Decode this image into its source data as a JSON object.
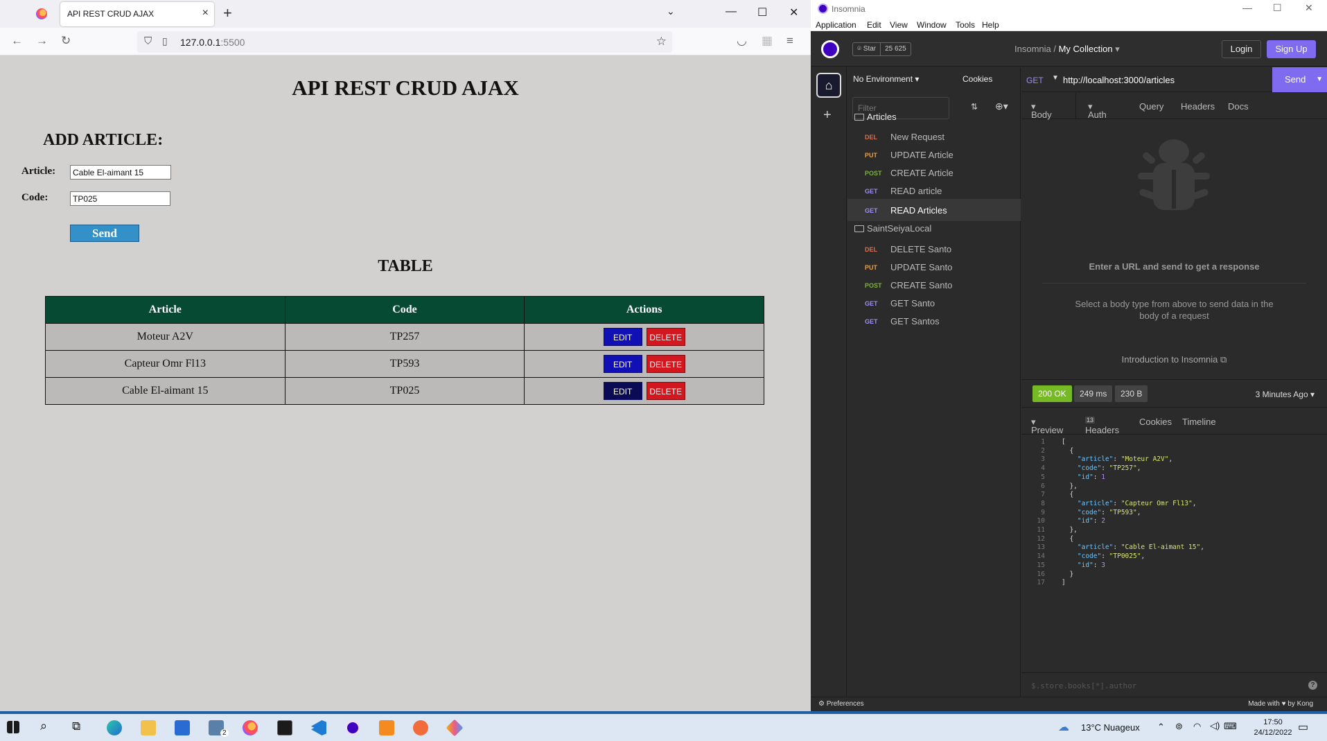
{
  "firefox": {
    "tab_title": "API REST CRUD AJAX",
    "url_host": "127.0.0.1",
    "url_port": ":5500"
  },
  "page": {
    "title": "API REST CRUD AJAX",
    "add_heading": "ADD ARTICLE:",
    "article_label": "Article:",
    "article_value": "Cable El-aimant 15",
    "code_label": "Code:",
    "code_value": "TP025",
    "send_label": "Send",
    "table_heading": "TABLE",
    "columns": [
      "Article",
      "Code",
      "Actions"
    ],
    "rows": [
      {
        "article": "Moteur A2V",
        "code": "TP257"
      },
      {
        "article": "Capteur Omr Fl13",
        "code": "TP593"
      },
      {
        "article": "Cable El-aimant 15",
        "code": "TP025"
      }
    ],
    "edit_label": "EDIT",
    "delete_label": "DELETE"
  },
  "insomnia": {
    "window_title": "Insomnia",
    "menu": [
      "Application",
      "Edit",
      "View",
      "Window",
      "Tools",
      "Help"
    ],
    "star_label": "Star",
    "star_count": "25 625",
    "breadcrumb_root": "Insomnia",
    "breadcrumb_sep": " / ",
    "collection": "My Collection",
    "login": "Login",
    "signup": "Sign Up",
    "environment": "No Environment",
    "cookies": "Cookies",
    "filter_placeholder": "Filter",
    "folders": [
      {
        "name": "Articles",
        "requests": [
          {
            "method": "DEL",
            "name": "New Request"
          },
          {
            "method": "PUT",
            "name": "UPDATE Article"
          },
          {
            "method": "POST",
            "name": "CREATE Article"
          },
          {
            "method": "GET",
            "name": "READ article"
          },
          {
            "method": "GET",
            "name": "READ Articles"
          }
        ]
      },
      {
        "name": "SaintSeiyaLocal",
        "requests": [
          {
            "method": "DEL",
            "name": "DELETE Santo"
          },
          {
            "method": "PUT",
            "name": "UPDATE Santo"
          },
          {
            "method": "POST",
            "name": "CREATE Santo"
          },
          {
            "method": "GET",
            "name": "GET Santo"
          },
          {
            "method": "GET",
            "name": "GET Santos"
          }
        ]
      }
    ],
    "active_request": "READ Articles",
    "method": "GET",
    "url": "http://localhost:3000/articles",
    "send": "Send",
    "request_tabs": [
      "Body",
      "Auth",
      "Query",
      "Headers",
      "Docs"
    ],
    "enter_url": "Enter a URL and send to get a response",
    "select_body": "Select a body type from above to send data in the body of a request",
    "intro": "Introduction to Insomnia",
    "status": "200 OK",
    "time": "249 ms",
    "size": "230 B",
    "ago": "3 Minutes Ago",
    "response_tabs": [
      "Preview",
      "Headers",
      "Cookies",
      "Timeline"
    ],
    "headers_count": "13",
    "json_lines": [
      "[",
      "  {",
      "    \"article\": \"Moteur A2V\",",
      "    \"code\": \"TP257\",",
      "    \"id\": 1",
      "  },",
      "  {",
      "    \"article\": \"Capteur Omr Fl13\",",
      "    \"code\": \"TP593\",",
      "    \"id\": 2",
      "  },",
      "  {",
      "    \"article\": \"Cable El-aimant 15\",",
      "    \"code\": \"TP0025\",",
      "    \"id\": 3",
      "  }",
      "]"
    ],
    "json_filter_placeholder": "$.store.books[*].author",
    "preferences": "Preferences",
    "made_with": "Made with ♥ by Kong"
  },
  "taskbar": {
    "weather_temp": "13°C",
    "weather_desc": "Nuageux",
    "time": "17:50",
    "date": "24/12/2022",
    "mail_badge": "2"
  },
  "colors": {
    "table_header": "#064a33",
    "edit_button": "#1010b4",
    "delete_button": "#d3171f",
    "send_button": "#3390c9",
    "insomnia_accent": "#7f6bf0",
    "status_ok": "#75ba24"
  }
}
